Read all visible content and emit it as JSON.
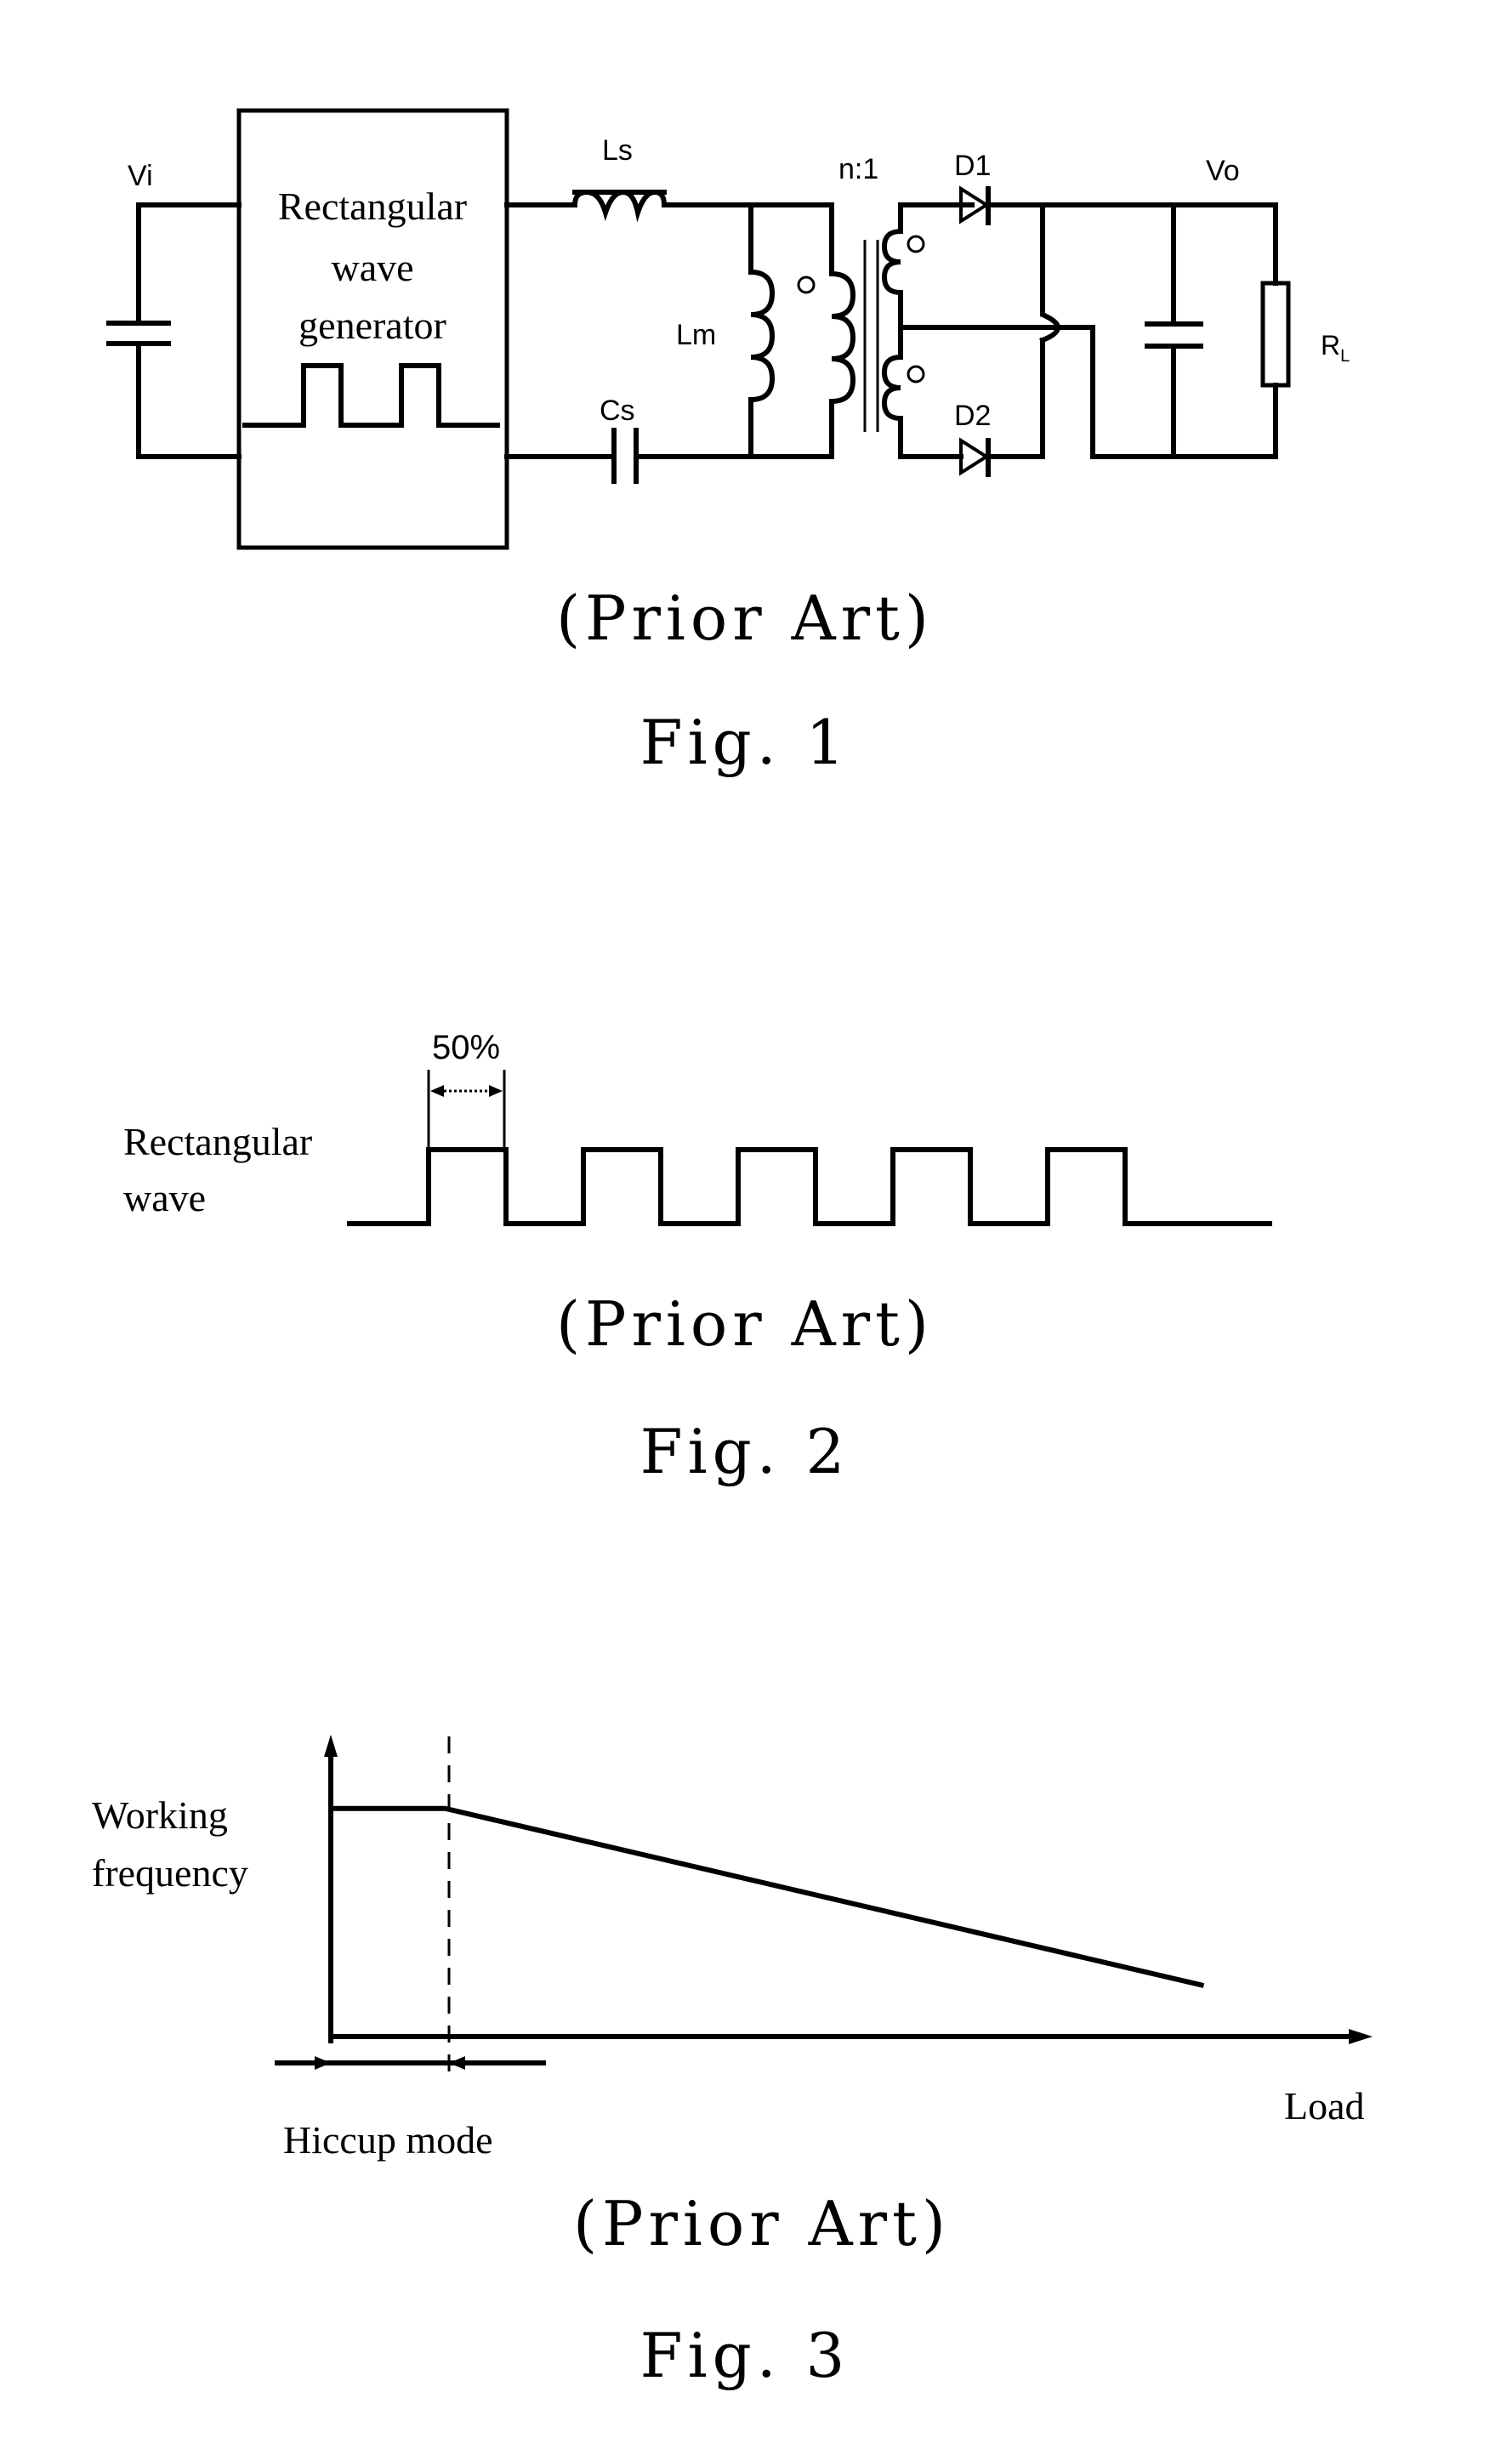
{
  "figures": [
    {
      "id": "fig1",
      "kind": "circuit",
      "caption_note": "(Prior Art)",
      "caption": "Fig. 1",
      "generator_block": {
        "lines": [
          "Rectangular",
          "wave",
          "generator"
        ]
      },
      "labels": {
        "input_voltage": "Vi",
        "series_inductor": "Ls",
        "series_capacitor": "Cs",
        "magnetizing_inductor": "Lm",
        "turns_ratio": "n:1",
        "diode_1": "D1",
        "diode_2": "D2",
        "output_voltage": "Vo",
        "load_resistor": "R",
        "load_resistor_sub": "L"
      }
    },
    {
      "id": "fig2",
      "kind": "waveform",
      "caption_note": "(Prior Art)",
      "caption": "Fig. 2",
      "signal_label": [
        "Rectangular",
        "wave"
      ],
      "duty_cycle_label": "50%",
      "duty_cycle": 0.5,
      "pulse_count": 5
    },
    {
      "id": "fig3",
      "kind": "graph",
      "caption_note": "(Prior Art)",
      "caption": "Fig. 3",
      "y_axis_label": [
        "Working",
        "frequency"
      ],
      "x_axis_label": "Load",
      "region_label": "Hiccup mode"
    }
  ],
  "chart_data": {
    "type": "line",
    "title": "",
    "xlabel": "Load",
    "ylabel": "Working frequency",
    "x_units": "relative load (0–1)",
    "y_units": "relative frequency (0–1)",
    "xlim": [
      0,
      1
    ],
    "ylim": [
      0,
      1
    ],
    "grid": false,
    "series": [
      {
        "name": "Working frequency",
        "x": [
          0,
          0.11,
          0.84
        ],
        "y": [
          0.76,
          0.76,
          0.17
        ]
      }
    ],
    "annotations": [
      {
        "text": "Hiccup mode",
        "x_range": [
          0,
          0.11
        ],
        "marker": "dashed vertical line at x=0.11"
      }
    ]
  }
}
